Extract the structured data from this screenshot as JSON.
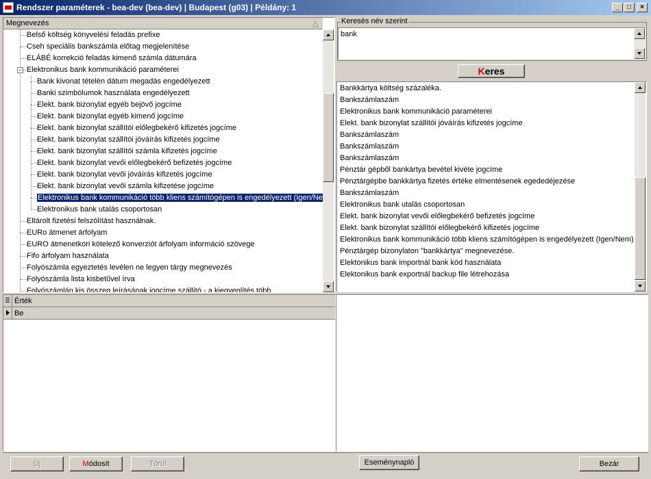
{
  "window": {
    "title": "Rendszer paraméterek - bea-dev (bea-dev) | Budapest (g03) | Példány: 1",
    "minimize": "_",
    "maximize": "□",
    "close": "×"
  },
  "tree": {
    "header": "Megnevezés",
    "sort_indicator": "△",
    "items": [
      {
        "label": "Belső költség könyvelési feladás prefixe",
        "level": 0
      },
      {
        "label": "Cseh speciális bankszámla előtag megjelenítése",
        "level": 0
      },
      {
        "label": "ELÁBÉ korrekció feladás kimenő számla dátumára",
        "level": 0
      },
      {
        "label": "Elektronikus bank kommunikáció paraméterei",
        "level": 0,
        "expanded": true,
        "expander": "−"
      },
      {
        "label": "Bank kivonat tételén dátum megadás engedélyezett",
        "level": 1
      },
      {
        "label": "Banki szimbólumok használata engedélyezett",
        "level": 1
      },
      {
        "label": "Elekt. bank bizonylat egyéb bejövő jogcíme",
        "level": 1
      },
      {
        "label": "Elekt. bank bizonylat egyéb kimenő jogcíme",
        "level": 1
      },
      {
        "label": "Elekt. bank bizonylat szállítói előlegbekérő kifizetés jogcíme",
        "level": 1
      },
      {
        "label": "Elekt. bank bizonylat szállítói jóváírás kifizetés jogcíme",
        "level": 1
      },
      {
        "label": "Elekt. bank bizonylat szállítói számla kifizetés jogcíme",
        "level": 1
      },
      {
        "label": "Elekt. bank bizonylat vevői előlegbekérő befizetés jogcíme",
        "level": 1
      },
      {
        "label": "Elekt. bank bizonylat vevői jóváírás kifizetés jogcíme",
        "level": 1
      },
      {
        "label": "Elekt. bank bizonylat vevői számla kifizetése jogcíme",
        "level": 1
      },
      {
        "label": "Elektronikus bank kommunikáció több kliens számítógépen is engedélyezett (Igen/Nem)",
        "level": 1,
        "selected": true
      },
      {
        "label": "Elektronikus bank utalás csoportosan",
        "level": 1
      },
      {
        "label": "Eltárolt fizetési felszólítást használnak.",
        "level": 0
      },
      {
        "label": "EURo átmenet árfolyam",
        "level": 0
      },
      {
        "label": "EURO átmenetkori kötelező konverziót árfolyam információ szövege",
        "level": 0
      },
      {
        "label": "Fifo árfolyam használata",
        "level": 0
      },
      {
        "label": "Folyószámla egyeztetés levélen ne legyen tárgy megnevezés",
        "level": 0
      },
      {
        "label": "Folyószámla lista kisbetűvel írva",
        "level": 0
      },
      {
        "label": "Folyószámlán kis összeg leírásának jogcíme szállító - a kiegyenlítés több",
        "level": 0
      }
    ]
  },
  "search": {
    "group_label": "Keresés név szerint",
    "query": "bank",
    "button_hotkey": "K",
    "button_rest": "eres",
    "results": [
      "Bankkártya költség százaléka.",
      "Bankszámlaszám",
      "Elektronikus bank kommunikáció paraméterei",
      "Elekt. bank bizonylat szállítói jóváírás kifizetés jogcíme",
      "Bankszámlaszám",
      "Bankszámlaszám",
      "Bankszámlaszám",
      "Pénztár gépből bankártya bevétel kivéte jogcíme",
      "Pénztárgépbe bankkártya fizetés értéke elmentésenek egededéjezése",
      "Bankszámlaszám",
      "Elektronikus bank utalás csoportosan",
      "Elekt. bank bizonylat vevői előlegbekérő befizetés jogcíme",
      "Elekt. bank bizonylat szállítói előlegbekérő kifizetés jogcíme",
      "Elektronikus bank kommunikáció több kliens számítógépen is engedélyezett (Igen/Nem)",
      "Pénztárgép bizonylaton \"bankkártya\" megnevezése.",
      "Elektonikus bank importnál bank kód használata",
      "Elektonikus bank exportnál backup file létrehozása"
    ]
  },
  "value_grid": {
    "header": "Érték",
    "rows": [
      {
        "value": "Be"
      }
    ]
  },
  "footer": {
    "new": "Új",
    "modify_hotkey": "M",
    "modify_rest": "ódosít",
    "delete": "Töröl",
    "event_log": "Eseménynapló",
    "close": "Bezár"
  }
}
